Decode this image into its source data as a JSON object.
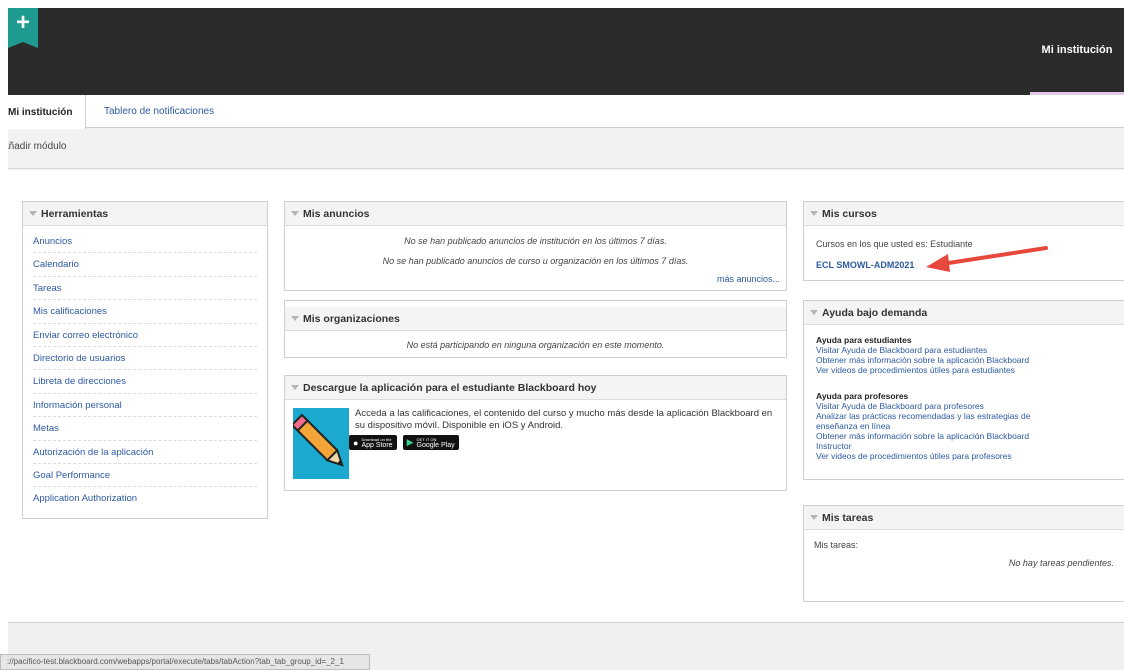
{
  "header": {
    "plus_label": "+",
    "institution_tab": "Mi institución"
  },
  "tabs": [
    {
      "label": "Mi institución",
      "active": true
    },
    {
      "label": "Tablero de notificaciones",
      "active": false
    }
  ],
  "add_module": "Añadir módulo",
  "tools": {
    "title": "Herramientas",
    "items": [
      "Anuncios",
      "Calendario",
      "Tareas",
      "Mis calificaciones",
      "Enviar correo electrónico",
      "Directorio de usuarios",
      "Libreta de direcciones",
      "Información personal",
      "Metas",
      "Autorización de la aplicación",
      "Goal Performance",
      "Application Authorization"
    ]
  },
  "announcements": {
    "title": "Mis anuncios",
    "msg1": "No se han publicado anuncios de institución en los últimos 7 días.",
    "msg2": "No se han publicado anuncios de curso u organización en los últimos 7 días.",
    "more": "más anuncios..."
  },
  "organizations": {
    "title": "Mis organizaciones",
    "msg": "No está participando en ninguna organización en este momento."
  },
  "app_promo": {
    "title": "Descargue la aplicación para el estudiante Blackboard hoy",
    "text": "Acceda a las calificaciones, el contenido del curso y mucho más desde la aplicación Blackboard en su dispositivo móvil. Disponible en iOS y Android.",
    "appstore_small": "Download on the",
    "appstore": "App Store",
    "googleplay_small": "GET IT ON",
    "googleplay": "Google Play"
  },
  "courses": {
    "title": "Mis cursos",
    "role_text": "Cursos en los que usted es: Estudiante",
    "course_link": "ECL SMOWL-ADM2021"
  },
  "help": {
    "title": "Ayuda bajo demanda",
    "students": {
      "heading": "Ayuda para estudiantes",
      "links": [
        "Visitar Ayuda de Blackboard para estudiantes",
        "Obtener más información sobre la aplicación Blackboard",
        "Ver videos de procedimientos útiles para estudiantes"
      ]
    },
    "instructors": {
      "heading": "Ayuda para profesores",
      "links": [
        "Visitar Ayuda de Blackboard para profesores",
        "Analizar las prácticas recomendadas y las estrategias de enseñanza en línea",
        "Obtener más información sobre la aplicación Blackboard Instructor",
        "Ver videos de procedimientos útiles para profesores"
      ]
    }
  },
  "tasks": {
    "title": "Mis tareas",
    "label": "Mis tareas:",
    "empty": "No hay tareas pendientes."
  },
  "status_url": "://pacifico-test.blackboard.com/webapps/portal/execute/tabs/tabAction?tab_tab_group_id=_2_1",
  "colors": {
    "header_bg": "#2b2b2b",
    "link": "#2d5aa0",
    "accent_arrow": "#e8473b",
    "teal": "#1e9a8f"
  }
}
